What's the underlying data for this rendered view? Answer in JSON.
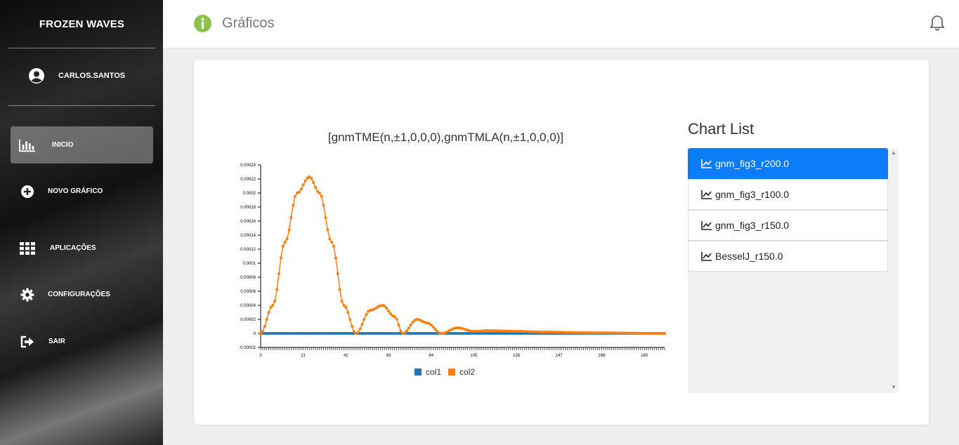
{
  "app": {
    "name": "FROZEN WAVES"
  },
  "user": {
    "name": "CARLOS.SANTOS",
    "icon": "user-circle-icon"
  },
  "nav": [
    {
      "label": "INICIO",
      "icon": "bar-chart-icon",
      "active": true
    },
    {
      "label": "NOVO GRÁFICO",
      "icon": "plus-circle-icon"
    },
    {
      "label": "APLICAÇÕES",
      "icon": "grid-icon"
    },
    {
      "label": "CONFIGURAÇÕES",
      "icon": "gear-icon"
    },
    {
      "label": "SAIR",
      "icon": "sign-out-icon"
    }
  ],
  "header": {
    "title": "Gráficos",
    "icon": "info-circle-icon",
    "bell_icon": "bell-icon"
  },
  "chart_list": {
    "title": "Chart List",
    "items": [
      "gnm_fig3_r200.0",
      "gnm_fig3_r100.0",
      "gnm_fig3_r150.0",
      "BesselJ_r150.0"
    ],
    "active_index": 0
  },
  "colors": {
    "accent": "#0d7cf8",
    "series1": "#1f77b4",
    "series2": "#ff7f0e",
    "info_green": "#8bc34a"
  },
  "chart_data": {
    "type": "line",
    "title": "[gnmTME(n,±1,0,0,0),gnmTMLA(n,±1,0,0,0)]",
    "xlim": [
      0,
      199
    ],
    "ylim": [
      -2e-05,
      0.00024
    ],
    "x_ticks": [
      0,
      21,
      42,
      63,
      84,
      105,
      126,
      147,
      168,
      189
    ],
    "y_ticks": [
      "-0.00002",
      "0",
      "0.00002",
      "0.00004",
      "0.00006",
      "0.00008",
      "0.0001",
      "0.00012",
      "0.00014",
      "0.00016",
      "0.00018",
      "0.0002",
      "0.00022",
      "0.00024"
    ],
    "legend_position": "bottom",
    "series": [
      {
        "name": "col1",
        "color": "#1f77b4",
        "values": "0 for n = 0..199"
      },
      {
        "name": "col2",
        "color": "#ff7f0e",
        "points": [
          [
            0,
            0
          ],
          [
            6,
            4e-05
          ],
          [
            12,
            0.00013
          ],
          [
            18,
            0.0002
          ],
          [
            24,
            0.000223
          ],
          [
            29,
            0.0002
          ],
          [
            35,
            0.00013
          ],
          [
            41,
            4e-05
          ],
          [
            47,
            0
          ],
          [
            54,
            3.3e-05
          ],
          [
            60,
            4e-05
          ],
          [
            66,
            2.4e-05
          ],
          [
            70,
            0
          ],
          [
            77,
            2e-05
          ],
          [
            82,
            1.5e-05
          ],
          [
            89,
            0
          ],
          [
            97,
            8e-06
          ],
          [
            105,
            3e-06
          ],
          [
            112,
            4e-06
          ],
          [
            126,
            3e-06
          ],
          [
            140,
            2e-06
          ],
          [
            160,
            1e-06
          ],
          [
            199,
            0
          ]
        ]
      }
    ]
  }
}
